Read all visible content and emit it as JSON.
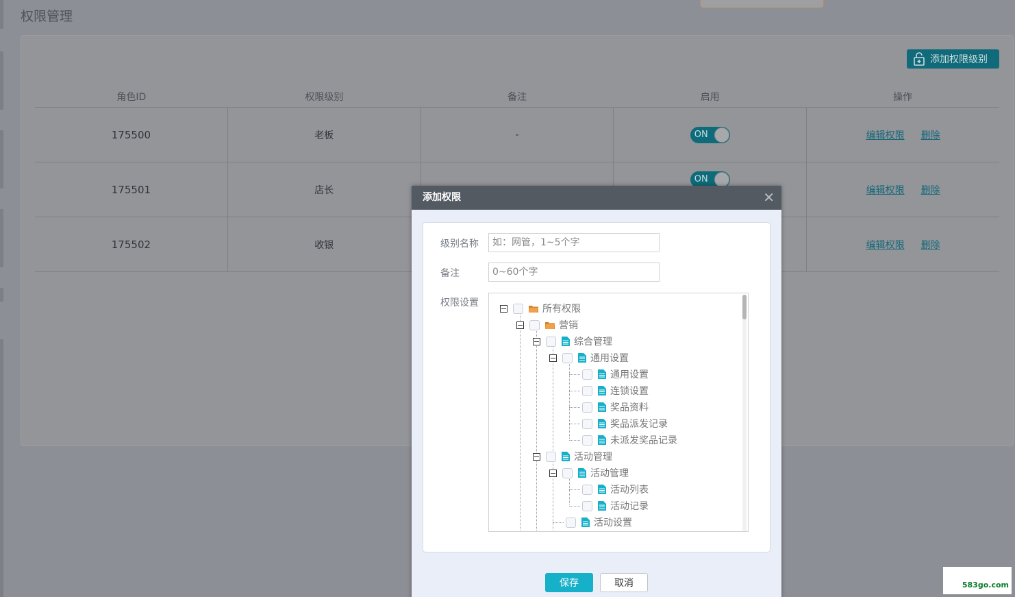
{
  "page": {
    "title": "权限管理",
    "add_level_label": "添加权限级别"
  },
  "table": {
    "headers": [
      "角色ID",
      "权限级别",
      "备注",
      "启用",
      "操作"
    ],
    "rows": [
      {
        "id": "175500",
        "level": "老板",
        "note": "-",
        "enabled": "ON"
      },
      {
        "id": "175501",
        "level": "店长",
        "note": "",
        "enabled": "ON"
      },
      {
        "id": "175502",
        "level": "收银",
        "note": "",
        "enabled": ""
      }
    ],
    "edit_label": "编辑权限",
    "delete_label": "删除"
  },
  "modal": {
    "title": "添加权限",
    "close_icon": "close-icon",
    "name_label": "级别名称",
    "name_placeholder": "如：网管，1~5个字",
    "note_label": "备注",
    "note_placeholder": "0~60个字",
    "perm_label": "权限设置",
    "tree": [
      {
        "label": "所有权限",
        "icon": "folder-icon"
      },
      {
        "label": "营销",
        "icon": "folder-icon"
      },
      {
        "label": "综合管理",
        "icon": "document-icon"
      },
      {
        "label": "通用设置",
        "icon": "document-icon"
      },
      {
        "label": "通用设置",
        "icon": "document-icon"
      },
      {
        "label": "连锁设置",
        "icon": "document-icon"
      },
      {
        "label": "奖品资料",
        "icon": "document-icon"
      },
      {
        "label": "奖品派发记录",
        "icon": "document-icon"
      },
      {
        "label": "未派发奖品记录",
        "icon": "document-icon"
      },
      {
        "label": "活动管理",
        "icon": "document-icon"
      },
      {
        "label": "活动管理",
        "icon": "document-icon"
      },
      {
        "label": "活动列表",
        "icon": "document-icon"
      },
      {
        "label": "活动记录",
        "icon": "document-icon"
      },
      {
        "label": "活动设置",
        "icon": "document-icon"
      }
    ],
    "save_label": "保存",
    "cancel_label": "取消"
  },
  "watermark": "583go.com",
  "colors": {
    "accent": "#17b0c9",
    "folder": "#d9822b",
    "doc": "#17b0c9",
    "link": "#17687a"
  }
}
